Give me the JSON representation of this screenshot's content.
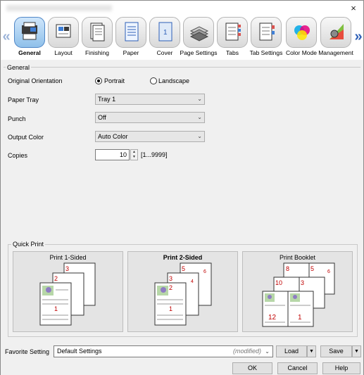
{
  "tabs": [
    {
      "id": "general",
      "label": "General",
      "icon": "general-icon"
    },
    {
      "id": "layout",
      "label": "Layout",
      "icon": "layout-icon"
    },
    {
      "id": "finishing",
      "label": "Finishing",
      "icon": "finishing-icon"
    },
    {
      "id": "paper",
      "label": "Paper",
      "icon": "paper-icon"
    },
    {
      "id": "cover",
      "label": "Cover",
      "icon": "cover-icon"
    },
    {
      "id": "page_settings",
      "label": "Page Settings",
      "icon": "page-settings-icon"
    },
    {
      "id": "tabs",
      "label": "Tabs",
      "icon": "tabs-icon"
    },
    {
      "id": "tab_settings",
      "label": "Tab Settings",
      "icon": "tab-settings-icon"
    },
    {
      "id": "color_mode",
      "label": "Color Mode",
      "icon": "color-mode-icon"
    },
    {
      "id": "management",
      "label": "Management",
      "icon": "management-icon"
    }
  ],
  "general": {
    "group_label": "General",
    "orientation_label": "Original Orientation",
    "portrait_label": "Portrait",
    "landscape_label": "Landscape",
    "orientation_selected": "Portrait",
    "paper_tray_label": "Paper Tray",
    "paper_tray_value": "Tray 1",
    "punch_label": "Punch",
    "punch_value": "Off",
    "output_color_label": "Output Color",
    "output_color_value": "Auto Color",
    "copies_label": "Copies",
    "copies_value": "10",
    "copies_range": "[1...9999]"
  },
  "quick_print": {
    "group_label": "Quick Print",
    "cards": [
      {
        "title": "Print 1-Sided",
        "selected": false,
        "page_numbers": [
          "3",
          "2",
          "1"
        ]
      },
      {
        "title": "Print 2-Sided",
        "selected": true,
        "page_numbers": [
          "5",
          "6",
          "3",
          "4",
          "2",
          "1"
        ]
      },
      {
        "title": "Print Booklet",
        "selected": false,
        "page_numbers": [
          "8",
          "5",
          "10",
          "3",
          "6",
          "12",
          "1"
        ]
      }
    ]
  },
  "favorite": {
    "label": "Favorite Setting",
    "value": "Default Settings",
    "status": "(modified)",
    "load_label": "Load",
    "save_label": "Save"
  },
  "footer": {
    "ok_label": "OK",
    "cancel_label": "Cancel",
    "help_label": "Help"
  },
  "window": {
    "close_glyph": "×"
  },
  "colors": {
    "active_tab": "#8fc0ea",
    "accent": "#2d5fb7",
    "page_number": "#c00000"
  }
}
